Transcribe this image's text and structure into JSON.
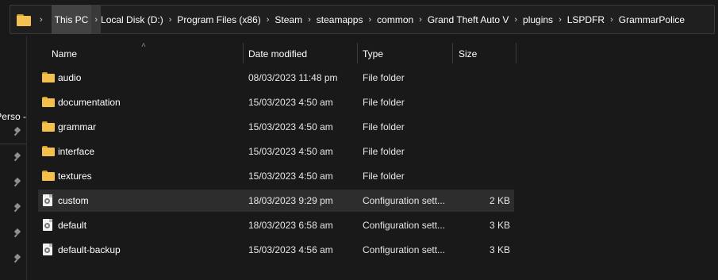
{
  "address_bar": {
    "icon": "folder-icon",
    "crumbs": [
      "This PC",
      "Local Disk (D:)",
      "Program Files (x86)",
      "Steam",
      "steamapps",
      "common",
      "Grand Theft Auto V",
      "plugins",
      "LSPDFR",
      "GrammarPolice"
    ]
  },
  "nav": {
    "partial_label": "- Perso"
  },
  "columns": {
    "name": "Name",
    "date": "Date modified",
    "type": "Type",
    "size": "Size"
  },
  "rows": [
    {
      "name": "audio",
      "date": "08/03/2023 11:48 pm",
      "type": "File folder",
      "size": "",
      "icon": "folder-icon"
    },
    {
      "name": "documentation",
      "date": "15/03/2023 4:50 am",
      "type": "File folder",
      "size": "",
      "icon": "folder-icon"
    },
    {
      "name": "grammar",
      "date": "15/03/2023 4:50 am",
      "type": "File folder",
      "size": "",
      "icon": "folder-icon"
    },
    {
      "name": "interface",
      "date": "15/03/2023 4:50 am",
      "type": "File folder",
      "size": "",
      "icon": "folder-icon"
    },
    {
      "name": "textures",
      "date": "15/03/2023 4:50 am",
      "type": "File folder",
      "size": "",
      "icon": "folder-icon"
    },
    {
      "name": "custom",
      "date": "18/03/2023 9:29 pm",
      "type": "Configuration sett...",
      "size": "2 KB",
      "icon": "config-file-icon",
      "selected": true
    },
    {
      "name": "default",
      "date": "18/03/2023 6:58 am",
      "type": "Configuration sett...",
      "size": "3 KB",
      "icon": "config-file-icon"
    },
    {
      "name": "default-backup",
      "date": "15/03/2023 4:56 am",
      "type": "Configuration sett...",
      "size": "3 KB",
      "icon": "config-file-icon"
    }
  ],
  "colors": {
    "background": "#191919",
    "selected_row": "#2d2d2d",
    "folder": "#f3bf4d",
    "text": "#ffffff"
  }
}
